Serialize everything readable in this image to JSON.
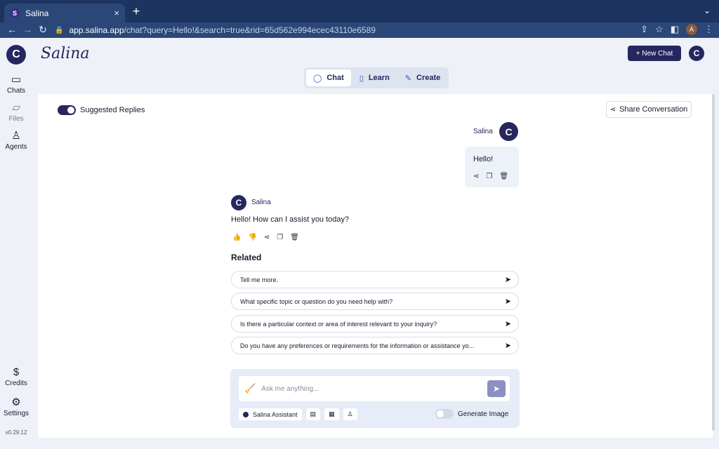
{
  "browser": {
    "tab_title": "Salina",
    "tab_close": "×",
    "new_tab": "+",
    "url_host": "app.salina.app",
    "url_path": "/chat?query=Hello!&search=true&rid=65d562e994ecec43110e6589",
    "profile_initial": "A"
  },
  "sidebar": {
    "logo": "C",
    "items": [
      {
        "label": "Chats",
        "icon": "chat-bubble-icon"
      },
      {
        "label": "Files",
        "icon": "folder-icon"
      },
      {
        "label": "Agents",
        "icon": "person-icon"
      },
      {
        "label": "Credits",
        "icon": "dollar-circle-icon"
      },
      {
        "label": "Settings",
        "icon": "gear-icon"
      }
    ],
    "version": "v0.29.12"
  },
  "header": {
    "brand": "Salina",
    "new_chat_label": "+ New Chat",
    "avatar": "C",
    "modes": [
      {
        "label": "Chat",
        "icon": "chat-icon",
        "active": true
      },
      {
        "label": "Learn",
        "icon": "book-icon",
        "active": false
      },
      {
        "label": "Create",
        "icon": "wand-icon",
        "active": false
      }
    ]
  },
  "panel": {
    "suggested_replies_label": "Suggested Replies",
    "share_conversation_label": "Share Conversation",
    "user_message": {
      "name": "Salina",
      "avatar": "C",
      "text": "Hello!"
    },
    "bot_message": {
      "name": "Salina",
      "avatar": "C",
      "text": "Hello! How can I assist you today?"
    },
    "related_heading": "Related",
    "related": [
      "Tell me more.",
      "What specific topic or question do you need help with?",
      "Is there a particular context or area of interest relevant to your inquiry?",
      "Do you have any preferences or requirements for the information or assistance yo..."
    ],
    "composer": {
      "placeholder": "Ask me anything...",
      "assistant_chip": "Salina Assistant",
      "generate_image_label": "Generate Image"
    }
  },
  "colors": {
    "brand": "#26275e",
    "browser_chrome": "#1d3461",
    "accent": "#3c4ac4"
  }
}
